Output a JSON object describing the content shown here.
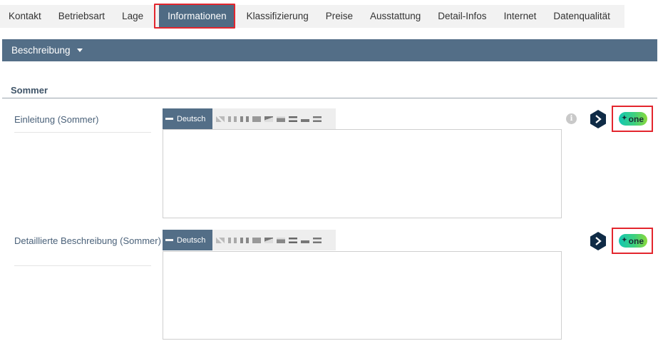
{
  "tabs": [
    {
      "label": "Kontakt",
      "active": false
    },
    {
      "label": "Betriebsart",
      "active": false
    },
    {
      "label": "Lage",
      "active": false
    },
    {
      "label": "Informationen",
      "active": true
    },
    {
      "label": "Klassifizierung",
      "active": false
    },
    {
      "label": "Preise",
      "active": false
    },
    {
      "label": "Ausstattung",
      "active": false
    },
    {
      "label": "Detail-Infos",
      "active": false
    },
    {
      "label": "Internet",
      "active": false
    },
    {
      "label": "Datenqualität",
      "active": false
    }
  ],
  "section": {
    "dropdown_label": "Beschreibung"
  },
  "season": {
    "title": "Sommer"
  },
  "fields": [
    {
      "label": "Einleitung (Sommer)",
      "language": "Deutsch",
      "value": ""
    },
    {
      "label": "Detaillierte Beschreibung (Sommer)",
      "language": "Deutsch",
      "value": ""
    }
  ],
  "icons": {
    "info": "info-icon",
    "deepl": "deepl-translate-icon",
    "one": "one-ai-badge"
  },
  "badge_text": "one",
  "info_glyph": "i",
  "colors": {
    "accent": "#536e87",
    "highlight": "#e3262e",
    "badge_start": "#13c7b3",
    "badge_end": "#8ad93a"
  }
}
